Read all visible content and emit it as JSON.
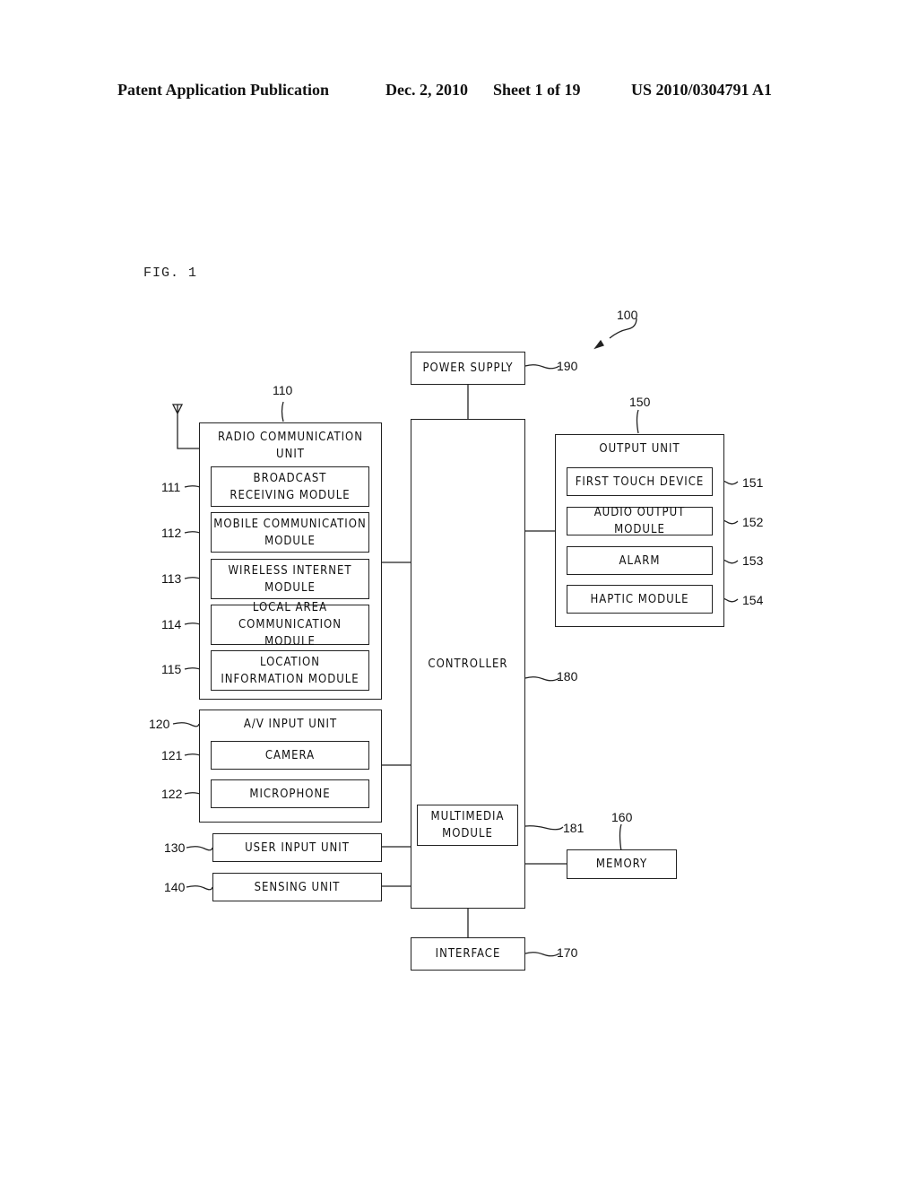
{
  "header": {
    "publication": "Patent Application Publication",
    "date": "Dec. 2, 2010",
    "sheet": "Sheet 1 of 19",
    "number": "US 2010/0304791 A1"
  },
  "figure_label": "FIG. 1",
  "device_ref": "100",
  "blocks": {
    "power_supply": {
      "label": "POWER SUPPLY",
      "ref": "190"
    },
    "radio_unit": {
      "label": "RADIO COMMUNICATION\nUNIT",
      "ref": "110"
    },
    "broadcast": {
      "label": "BROADCAST\nRECEIVING MODULE",
      "ref": "111"
    },
    "mobile_comm": {
      "label": "MOBILE COMMUNICATION\nMODULE",
      "ref": "112"
    },
    "wireless_internet": {
      "label": "WIRELESS INTERNET\nMODULE",
      "ref": "113"
    },
    "local_area": {
      "label": "LOCAL AREA\nCOMMUNICATION MODULE",
      "ref": "114"
    },
    "location_info": {
      "label": "LOCATION\nINFORMATION MODULE",
      "ref": "115"
    },
    "av_input": {
      "label": "A/V INPUT UNIT",
      "ref": "120"
    },
    "camera": {
      "label": "CAMERA",
      "ref": "121"
    },
    "microphone": {
      "label": "MICROPHONE",
      "ref": "122"
    },
    "user_input": {
      "label": "USER INPUT UNIT",
      "ref": "130"
    },
    "sensing": {
      "label": "SENSING UNIT",
      "ref": "140"
    },
    "controller": {
      "label": "CONTROLLER",
      "ref": "180"
    },
    "multimedia": {
      "label": "MULTIMEDIA\nMODULE",
      "ref": "181"
    },
    "output_unit": {
      "label": "OUTPUT UNIT",
      "ref": "150"
    },
    "first_touch": {
      "label": "FIRST TOUCH DEVICE",
      "ref": "151"
    },
    "audio_output": {
      "label": "AUDIO OUTPUT MODULE",
      "ref": "152"
    },
    "alarm": {
      "label": "ALARM",
      "ref": "153"
    },
    "haptic": {
      "label": "HAPTIC MODULE",
      "ref": "154"
    },
    "memory": {
      "label": "MEMORY",
      "ref": "160"
    },
    "interface": {
      "label": "INTERFACE",
      "ref": "170"
    }
  }
}
